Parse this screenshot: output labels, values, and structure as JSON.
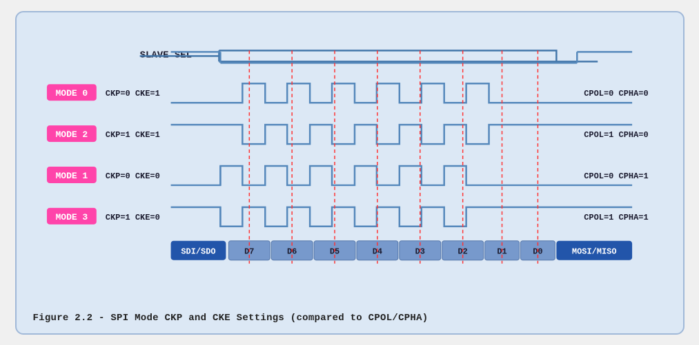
{
  "caption": "Figure 2.2 - SPI Mode CKP and CKE Settings (compared to CPOL/CPHA)",
  "diagram": {
    "slave_sel_label": "SLAVE SEL",
    "rows": [
      {
        "mode_label": "MODE 0",
        "params": "CKP=0  CKE=1",
        "right_params": "CPOL=0  CPHA=0"
      },
      {
        "mode_label": "MODE 2",
        "params": "CKP=1  CKE=1",
        "right_params": "CPOL=1  CPHA=0"
      },
      {
        "mode_label": "MODE 1",
        "params": "CKP=0  CKE=0",
        "right_params": "CPOL=0  CPHA=1"
      },
      {
        "mode_label": "MODE 3",
        "params": "CKP=1  CKE=0",
        "right_params": "CPOL=1  CPHA=1"
      }
    ],
    "data_labels": [
      "SDI/SDO",
      "D7",
      "D6",
      "D5",
      "D4",
      "D3",
      "D2",
      "D1",
      "D0",
      "MOSI/MISO"
    ]
  }
}
